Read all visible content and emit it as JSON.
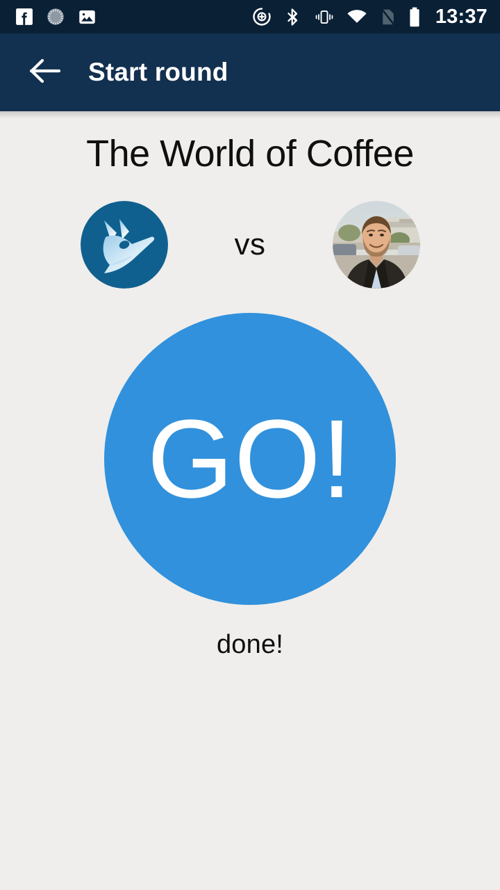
{
  "status_bar": {
    "time": "13:37",
    "icons_left": [
      "facebook-icon",
      "sync-spinner-icon",
      "photo-icon"
    ],
    "icons_right": [
      "location-add-icon",
      "bluetooth-icon",
      "vibrate-icon",
      "wifi-icon",
      "no-sim-icon",
      "battery-icon"
    ],
    "background_color": "#0a2035",
    "foreground_color": "#ffffff"
  },
  "app_bar": {
    "title": "Start round",
    "back_icon": "arrow-left-icon",
    "background_color": "#12304f",
    "text_color": "#ffffff"
  },
  "main": {
    "quiz_title": "The World of Coffee",
    "vs_label": "vs",
    "player_left": {
      "avatar": "fox-logo-avatar",
      "avatar_background": "#105c8c",
      "avatar_foreground": "#bcdcf2"
    },
    "player_right": {
      "avatar": "photo-portrait-avatar"
    },
    "go_button": {
      "label": "GO!",
      "color": "#3191dc",
      "text_color": "#ffffff"
    },
    "status_message": "done!",
    "background_color": "#efeeec",
    "text_color": "#0f0f0f"
  }
}
